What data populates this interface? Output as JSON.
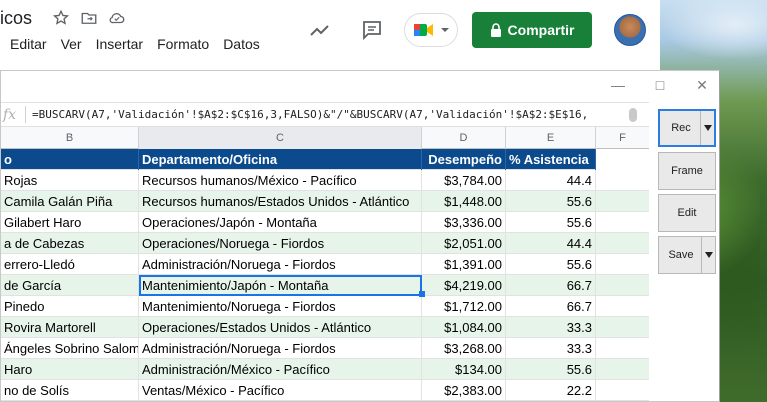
{
  "doc": {
    "title": "icos"
  },
  "menu": [
    "Editar",
    "Ver",
    "Insertar",
    "Formato",
    "Datos"
  ],
  "toolbar": {
    "share_label": "Compartir"
  },
  "formula_bar": {
    "fx": "fx",
    "formula": "=BUSCARV(A7,'Validación'!$A$2:$C$16,3,FALSO)&\"/\"&BUSCARV(A7,'Validación'!$A$2:$E$16,"
  },
  "columns": [
    "B",
    "C",
    "D",
    "E",
    "F"
  ],
  "table": {
    "headers": [
      "o",
      "Departamento/Oficina",
      "Desempeño",
      "% Asistencia"
    ],
    "rows": [
      [
        "Rojas",
        "Recursos humanos/México - Pacífico",
        "$3,784.00",
        "44.4"
      ],
      [
        "Camila Galán Piña",
        "Recursos humanos/Estados Unidos - Atlántico",
        "$1,448.00",
        "55.6"
      ],
      [
        "Gilabert Haro",
        "Operaciones/Japón - Montaña",
        "$3,336.00",
        "55.6"
      ],
      [
        "a de Cabezas",
        "Operaciones/Noruega - Fiordos",
        "$2,051.00",
        "44.4"
      ],
      [
        "errero-Lledó",
        "Administración/Noruega - Fiordos",
        "$1,391.00",
        "55.6"
      ],
      [
        "de García",
        "Mantenimiento/Japón - Montaña",
        "$4,219.00",
        "66.7"
      ],
      [
        "Pinedo",
        "Mantenimiento/Noruega - Fiordos",
        "$1,712.00",
        "66.7"
      ],
      [
        "Rovira Martorell",
        "Operaciones/Estados Unidos - Atlántico",
        "$1,084.00",
        "33.3"
      ],
      [
        "Ángeles Sobrino Salom",
        "Administración/Noruega - Fiordos",
        "$3,268.00",
        "33.3"
      ],
      [
        "Haro",
        "Administración/México - Pacífico",
        "$134.00",
        "55.6"
      ],
      [
        "no de Solís",
        "Ventas/México - Pacífico",
        "$2,383.00",
        "22.2"
      ]
    ]
  },
  "side_buttons": [
    {
      "label": "Rec",
      "dropdown": true,
      "active": true
    },
    {
      "label": "Frame",
      "dropdown": false
    },
    {
      "label": "Edit",
      "dropdown": false
    },
    {
      "label": "Save",
      "dropdown": true
    }
  ],
  "colors": {
    "header_bg": "#0b4a8c",
    "alt_row": "#e6f4ea",
    "share_green": "#188038",
    "selection": "#1a73e8"
  }
}
